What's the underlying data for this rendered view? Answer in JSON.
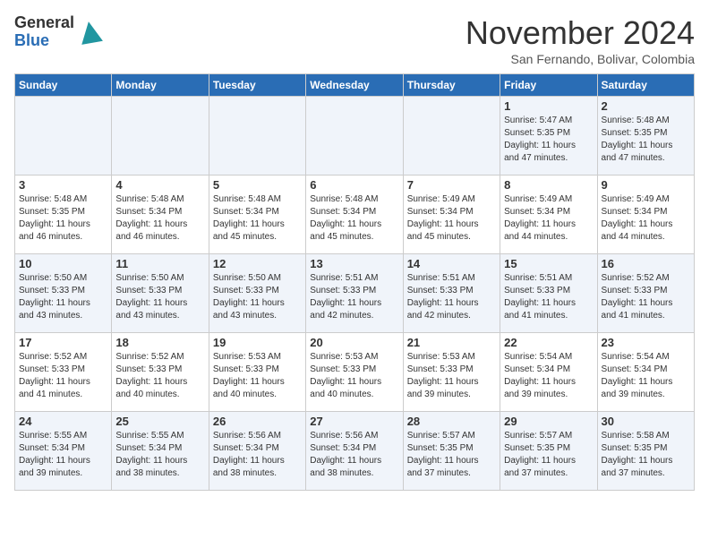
{
  "header": {
    "logo_line1": "General",
    "logo_line2": "Blue",
    "month_title": "November 2024",
    "location": "San Fernando, Bolivar, Colombia"
  },
  "days_of_week": [
    "Sunday",
    "Monday",
    "Tuesday",
    "Wednesday",
    "Thursday",
    "Friday",
    "Saturday"
  ],
  "weeks": [
    [
      {
        "day": "",
        "info": ""
      },
      {
        "day": "",
        "info": ""
      },
      {
        "day": "",
        "info": ""
      },
      {
        "day": "",
        "info": ""
      },
      {
        "day": "",
        "info": ""
      },
      {
        "day": "1",
        "info": "Sunrise: 5:47 AM\nSunset: 5:35 PM\nDaylight: 11 hours\nand 47 minutes."
      },
      {
        "day": "2",
        "info": "Sunrise: 5:48 AM\nSunset: 5:35 PM\nDaylight: 11 hours\nand 47 minutes."
      }
    ],
    [
      {
        "day": "3",
        "info": "Sunrise: 5:48 AM\nSunset: 5:35 PM\nDaylight: 11 hours\nand 46 minutes."
      },
      {
        "day": "4",
        "info": "Sunrise: 5:48 AM\nSunset: 5:34 PM\nDaylight: 11 hours\nand 46 minutes."
      },
      {
        "day": "5",
        "info": "Sunrise: 5:48 AM\nSunset: 5:34 PM\nDaylight: 11 hours\nand 45 minutes."
      },
      {
        "day": "6",
        "info": "Sunrise: 5:48 AM\nSunset: 5:34 PM\nDaylight: 11 hours\nand 45 minutes."
      },
      {
        "day": "7",
        "info": "Sunrise: 5:49 AM\nSunset: 5:34 PM\nDaylight: 11 hours\nand 45 minutes."
      },
      {
        "day": "8",
        "info": "Sunrise: 5:49 AM\nSunset: 5:34 PM\nDaylight: 11 hours\nand 44 minutes."
      },
      {
        "day": "9",
        "info": "Sunrise: 5:49 AM\nSunset: 5:34 PM\nDaylight: 11 hours\nand 44 minutes."
      }
    ],
    [
      {
        "day": "10",
        "info": "Sunrise: 5:50 AM\nSunset: 5:33 PM\nDaylight: 11 hours\nand 43 minutes."
      },
      {
        "day": "11",
        "info": "Sunrise: 5:50 AM\nSunset: 5:33 PM\nDaylight: 11 hours\nand 43 minutes."
      },
      {
        "day": "12",
        "info": "Sunrise: 5:50 AM\nSunset: 5:33 PM\nDaylight: 11 hours\nand 43 minutes."
      },
      {
        "day": "13",
        "info": "Sunrise: 5:51 AM\nSunset: 5:33 PM\nDaylight: 11 hours\nand 42 minutes."
      },
      {
        "day": "14",
        "info": "Sunrise: 5:51 AM\nSunset: 5:33 PM\nDaylight: 11 hours\nand 42 minutes."
      },
      {
        "day": "15",
        "info": "Sunrise: 5:51 AM\nSunset: 5:33 PM\nDaylight: 11 hours\nand 41 minutes."
      },
      {
        "day": "16",
        "info": "Sunrise: 5:52 AM\nSunset: 5:33 PM\nDaylight: 11 hours\nand 41 minutes."
      }
    ],
    [
      {
        "day": "17",
        "info": "Sunrise: 5:52 AM\nSunset: 5:33 PM\nDaylight: 11 hours\nand 41 minutes."
      },
      {
        "day": "18",
        "info": "Sunrise: 5:52 AM\nSunset: 5:33 PM\nDaylight: 11 hours\nand 40 minutes."
      },
      {
        "day": "19",
        "info": "Sunrise: 5:53 AM\nSunset: 5:33 PM\nDaylight: 11 hours\nand 40 minutes."
      },
      {
        "day": "20",
        "info": "Sunrise: 5:53 AM\nSunset: 5:33 PM\nDaylight: 11 hours\nand 40 minutes."
      },
      {
        "day": "21",
        "info": "Sunrise: 5:53 AM\nSunset: 5:33 PM\nDaylight: 11 hours\nand 39 minutes."
      },
      {
        "day": "22",
        "info": "Sunrise: 5:54 AM\nSunset: 5:34 PM\nDaylight: 11 hours\nand 39 minutes."
      },
      {
        "day": "23",
        "info": "Sunrise: 5:54 AM\nSunset: 5:34 PM\nDaylight: 11 hours\nand 39 minutes."
      }
    ],
    [
      {
        "day": "24",
        "info": "Sunrise: 5:55 AM\nSunset: 5:34 PM\nDaylight: 11 hours\nand 39 minutes."
      },
      {
        "day": "25",
        "info": "Sunrise: 5:55 AM\nSunset: 5:34 PM\nDaylight: 11 hours\nand 38 minutes."
      },
      {
        "day": "26",
        "info": "Sunrise: 5:56 AM\nSunset: 5:34 PM\nDaylight: 11 hours\nand 38 minutes."
      },
      {
        "day": "27",
        "info": "Sunrise: 5:56 AM\nSunset: 5:34 PM\nDaylight: 11 hours\nand 38 minutes."
      },
      {
        "day": "28",
        "info": "Sunrise: 5:57 AM\nSunset: 5:35 PM\nDaylight: 11 hours\nand 37 minutes."
      },
      {
        "day": "29",
        "info": "Sunrise: 5:57 AM\nSunset: 5:35 PM\nDaylight: 11 hours\nand 37 minutes."
      },
      {
        "day": "30",
        "info": "Sunrise: 5:58 AM\nSunset: 5:35 PM\nDaylight: 11 hours\nand 37 minutes."
      }
    ]
  ]
}
